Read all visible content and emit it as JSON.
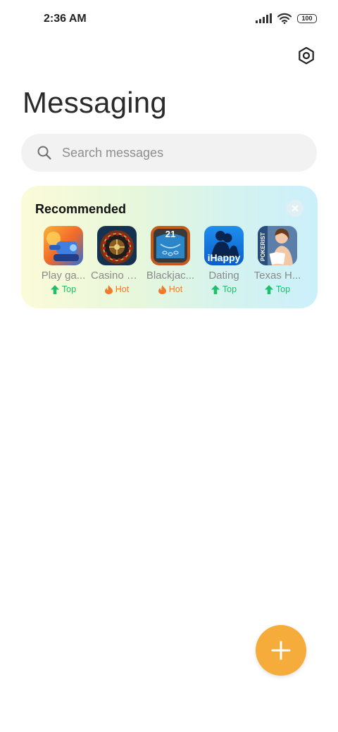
{
  "status_bar": {
    "time": "2:36 AM",
    "battery": "100"
  },
  "header": {
    "title": "Messaging"
  },
  "search": {
    "placeholder": "Search messages"
  },
  "recommended": {
    "title": "Recommended",
    "apps": [
      {
        "name": "Play ga...",
        "badge": "Top",
        "badge_type": "top"
      },
      {
        "name": "Casino R...",
        "badge": "Hot",
        "badge_type": "hot"
      },
      {
        "name": "Blackjac...",
        "badge": "Hot",
        "badge_type": "hot"
      },
      {
        "name": "Dating",
        "badge": "Top",
        "badge_type": "top",
        "icon_text": "iHappy"
      },
      {
        "name": "Texas H...",
        "badge": "Top",
        "badge_type": "top",
        "icon_text": "POKERIST"
      }
    ],
    "blackjack_icon_text": "21"
  },
  "colors": {
    "accent": "#f5ac3b",
    "top_badge": "#1fbf6e",
    "hot_badge": "#f07a2a"
  },
  "icons": {
    "settings": "settings-hexagon-icon",
    "search": "search-icon",
    "close": "close-icon",
    "add": "plus-icon"
  }
}
